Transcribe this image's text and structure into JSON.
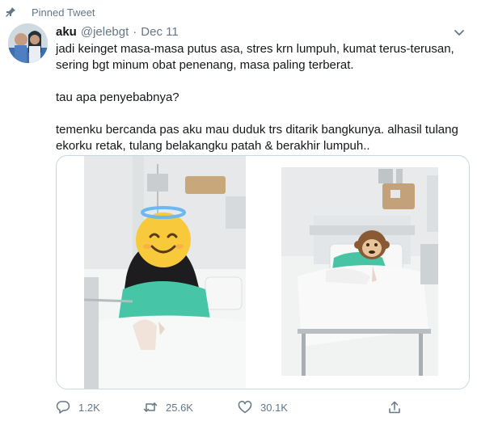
{
  "pinned_label": "Pinned Tweet",
  "author": {
    "name": "aku",
    "handle": "@jelebgt",
    "separator": "·",
    "date": "Dec 11"
  },
  "tweet_lines": [
    "jadi keinget masa-masa putus asa, stres krn lumpuh, kumat terus-terusan,",
    "sering bgt minum obat penenang, masa paling terberat.",
    "tau apa penyebabnya?",
    "temenku bercanda pas aku mau duduk trs ditarik bangkunya. alhasil tulang",
    "ekorku retak, tulang belakangku patah & berakhir lumpuh.."
  ],
  "actions": {
    "reply_count": "1.2K",
    "retweet_count": "25.6K",
    "like_count": "30.1K"
  },
  "icons": {
    "pin": "pin-icon",
    "caret": "chevron-down-icon",
    "reply": "reply-icon",
    "retweet": "retweet-icon",
    "like": "heart-icon",
    "share": "share-icon",
    "emoji_1": "smiling-face-with-halo",
    "emoji_2": "see-no-evil-monkey"
  },
  "colors": {
    "secondary_text": "#657786",
    "primary_text": "#14171a",
    "border": "#ccd6dd"
  }
}
